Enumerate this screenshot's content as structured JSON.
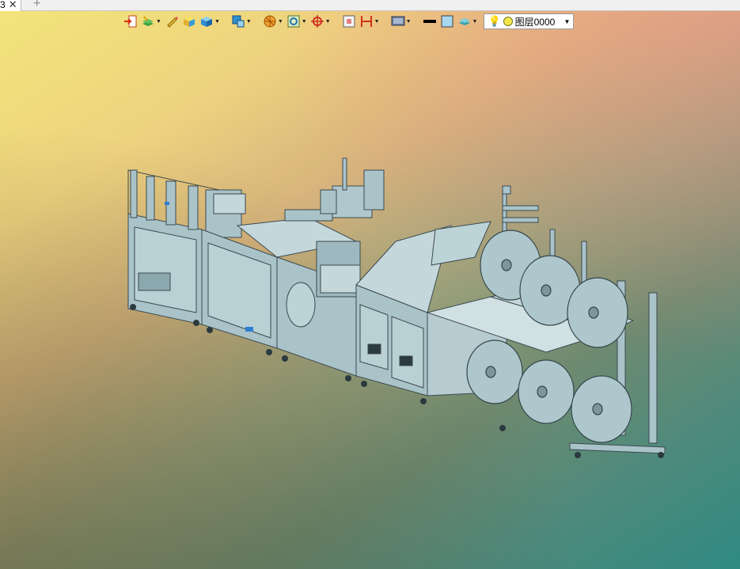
{
  "tabs": [
    {
      "label": "3",
      "active": true
    }
  ],
  "tabstrip": {
    "new_tab_label": "+"
  },
  "toolbar": {
    "items": [
      {
        "name": "import-icon",
        "dropdown": false
      },
      {
        "name": "layer-stack-icon",
        "dropdown": true
      },
      {
        "name": "pencil-icon",
        "dropdown": false
      },
      {
        "name": "box-yellow-icon",
        "dropdown": false
      },
      {
        "name": "box-blue-icon",
        "dropdown": true
      },
      {
        "name": "view-cube-icon",
        "dropdown": true
      },
      {
        "name": "section-orange-icon",
        "dropdown": true
      },
      {
        "name": "render-mode-icon",
        "dropdown": true
      },
      {
        "name": "crosshair-icon",
        "dropdown": true
      },
      {
        "name": "frame-icon",
        "dropdown": false
      },
      {
        "name": "dimension-icon",
        "dropdown": true
      },
      {
        "name": "display-icon",
        "dropdown": true
      },
      {
        "name": "line-color-icon",
        "dropdown": false
      },
      {
        "name": "fill-color-icon",
        "dropdown": false
      },
      {
        "name": "layer-icon",
        "dropdown": true
      }
    ],
    "layer_combo": {
      "value": "图层0000"
    }
  },
  "colors": {
    "model_fill": "#a9c3c9",
    "model_stroke": "#3c4a4f",
    "accent_blue": "#2f7fd0"
  }
}
